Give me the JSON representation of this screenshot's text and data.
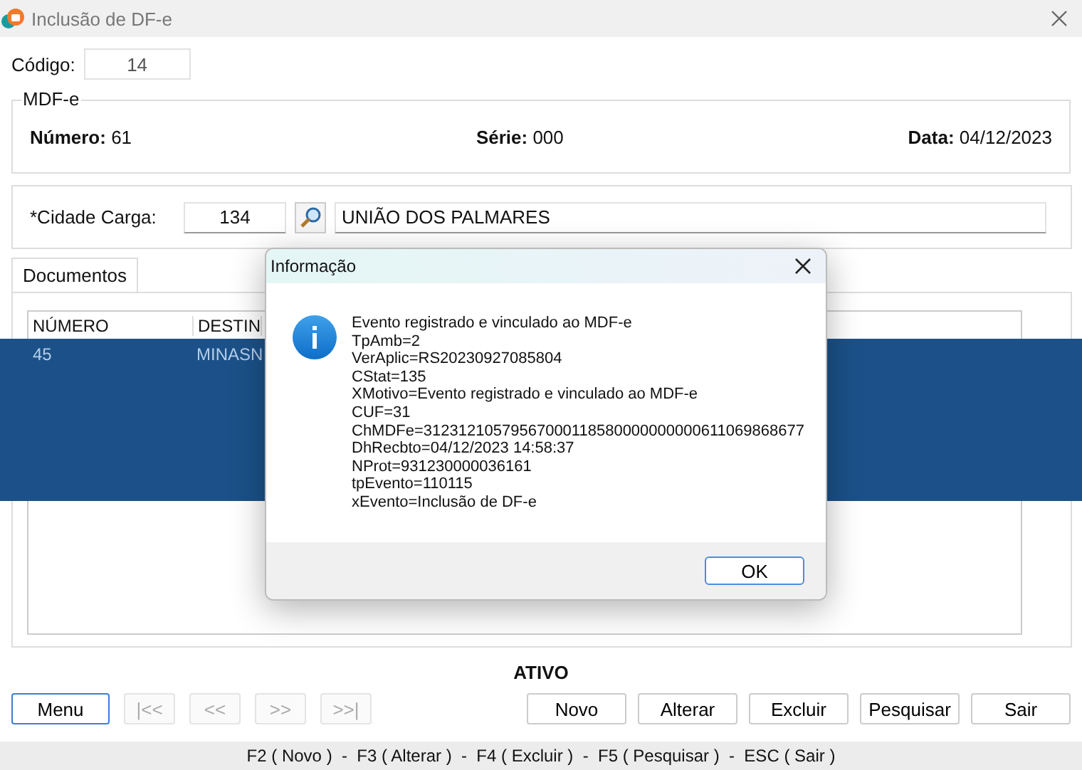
{
  "window": {
    "title": "Inclusão de DF-e"
  },
  "codigo": {
    "label": "Código:",
    "value": "14"
  },
  "mdfe": {
    "legend": "MDF-e",
    "fields": [
      {
        "label": "Número:",
        "value": "61"
      },
      {
        "label": "Série:",
        "value": "000"
      },
      {
        "label": "Data:",
        "value": "04/12/2023"
      }
    ]
  },
  "cidade": {
    "label": "*Cidade Carga:",
    "code": "134",
    "name": "UNIÃO DOS PALMARES"
  },
  "tabs": [
    {
      "label": "Documentos",
      "selected": true
    }
  ],
  "table": {
    "columns": [
      "NÚMERO",
      "DESTIN"
    ],
    "rows": [
      {
        "cells": [
          "45",
          "MINASN"
        ]
      }
    ]
  },
  "status_label": "ATIVO",
  "nav_buttons": [
    {
      "label": "Menu",
      "disabled": false
    },
    {
      "label": "|<<",
      "disabled": true
    },
    {
      "label": "<<",
      "disabled": true
    },
    {
      "label": ">>",
      "disabled": true
    },
    {
      "label": ">>|",
      "disabled": true
    }
  ],
  "action_buttons": [
    "Novo",
    "Alterar",
    "Excluir",
    "Pesquisar",
    "Sair"
  ],
  "status_bar": "F2 ( Novo )  -  F3 ( Alterar )  -  F4 ( Excluir )  -  F5 ( Pesquisar )  -  ESC ( Sair )",
  "dialog": {
    "title": "Informação",
    "lines": [
      "Evento registrado e vinculado ao MDF-e",
      "TpAmb=2",
      "VerAplic=RS20230927085804",
      "CStat=135",
      "XMotivo=Evento registrado e vinculado ao MDF-e",
      "CUF=31",
      "ChMDFe=31231210579567000118580000000000611069868677",
      "DhRecbto=04/12/2023 14:58:37",
      "NProt=931230000036161",
      "tpEvento=110115",
      "xEvento=Inclusão de DF-e"
    ],
    "button": "OK"
  }
}
